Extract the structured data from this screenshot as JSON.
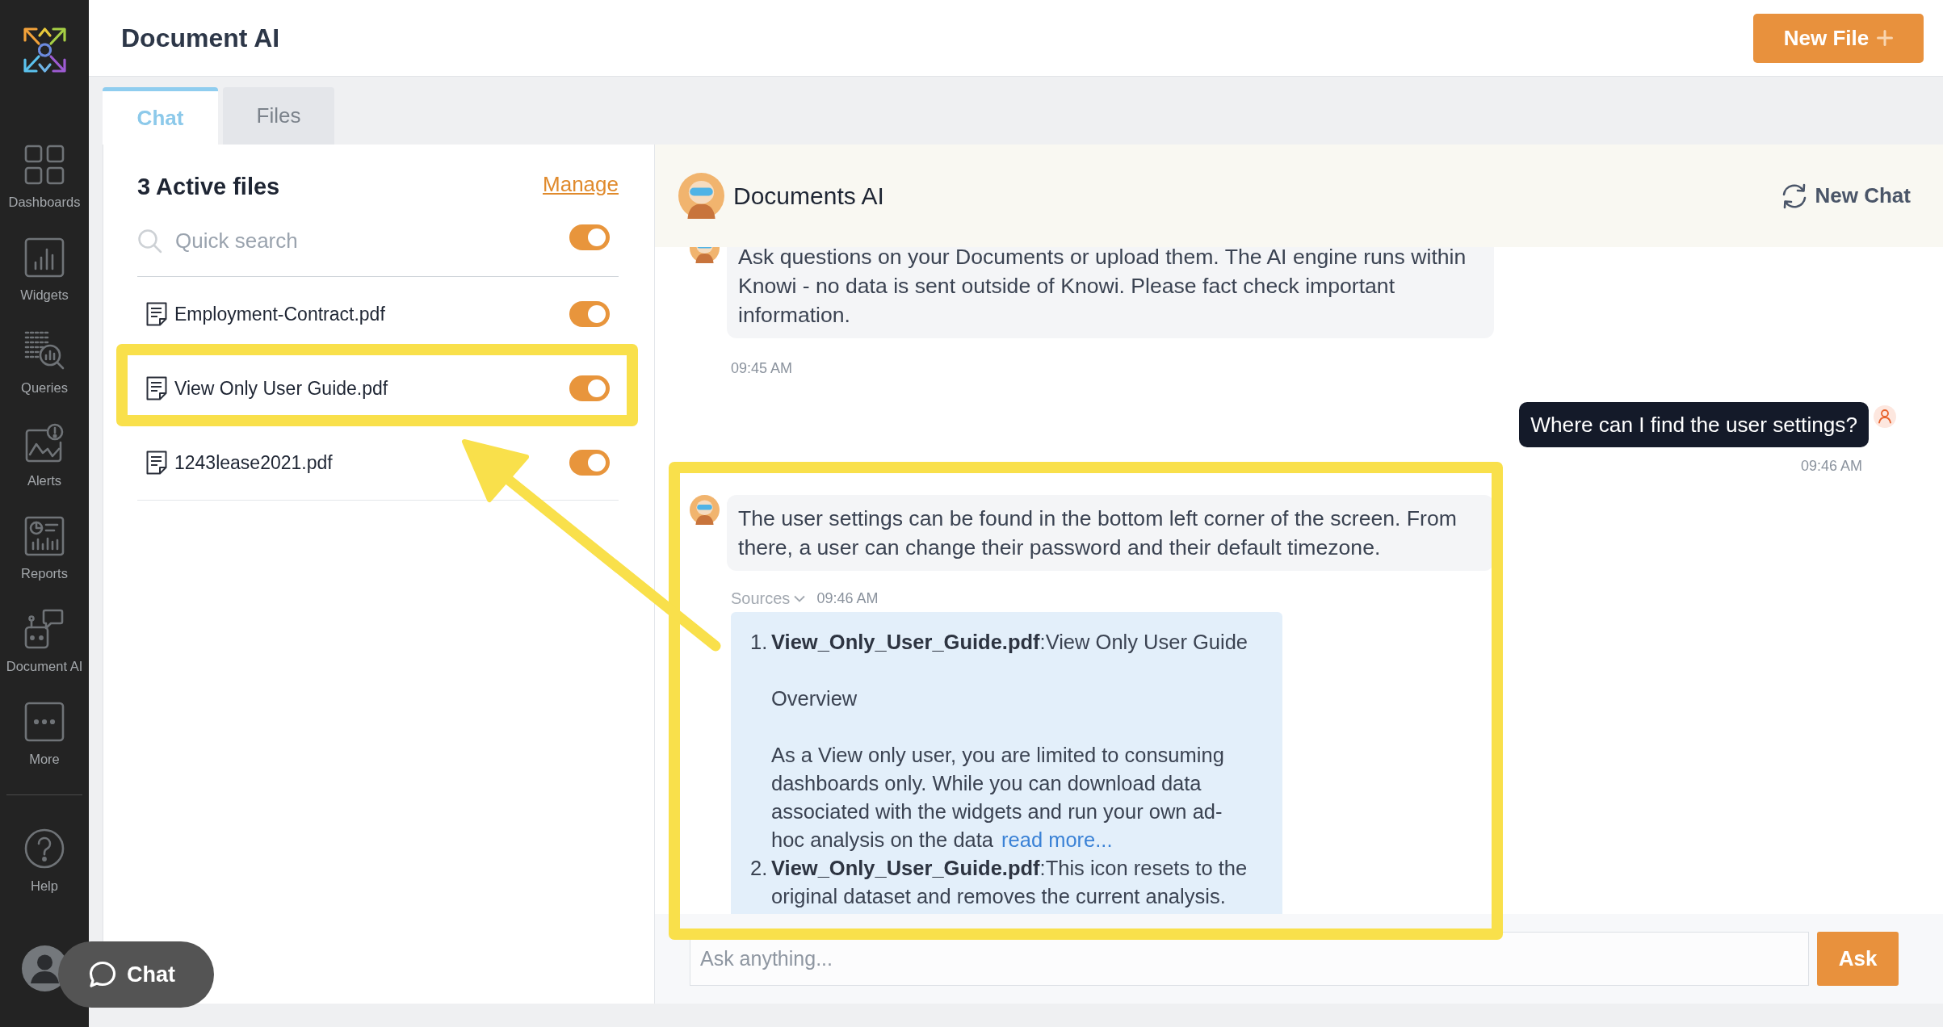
{
  "sidebar": {
    "items": [
      {
        "label": "Dashboards"
      },
      {
        "label": "Widgets"
      },
      {
        "label": "Queries"
      },
      {
        "label": "Alerts"
      },
      {
        "label": "Reports"
      },
      {
        "label": "Document AI"
      },
      {
        "label": "More"
      }
    ],
    "help": {
      "label": "Help"
    }
  },
  "header": {
    "title": "Document AI",
    "new_file_button": "New File"
  },
  "tabs": [
    {
      "label": "Chat",
      "selected": true
    },
    {
      "label": "Files",
      "selected": false
    }
  ],
  "files_panel": {
    "title": "3 Active files",
    "manage_link": "Manage",
    "search": {
      "placeholder": "Quick search",
      "toggle_on": true
    },
    "files": [
      {
        "name": "Employment-Contract.pdf",
        "on": true,
        "highlighted": false
      },
      {
        "name": "View Only User Guide.pdf",
        "on": true,
        "highlighted": true
      },
      {
        "name": "1243lease2021.pdf",
        "on": true,
        "highlighted": false
      }
    ]
  },
  "conversation": {
    "title": "Documents AI",
    "new_chat_button": "New Chat",
    "messages": [
      {
        "kind": "bot",
        "text": "Ask questions on your Documents or upload them. The AI engine runs within Knowi - no data is sent outside of Knowi. Please fact check important information.",
        "time": "09:45 AM",
        "highlighted": false
      },
      {
        "kind": "user",
        "text": "Where can I find the user settings?",
        "time": "09:46 AM",
        "highlighted": false
      },
      {
        "kind": "bot",
        "text": "The user settings can be found in the bottom left corner of the screen. From there, a user can change their password and their default timezone.",
        "sources_label": "Sources",
        "time": "09:46 AM",
        "highlighted": true,
        "sources": [
          {
            "number": "1.",
            "title": "**View_Only_User_Guide.pdf**:View Only User Guide",
            "paragraphs": [
              "Overview",
              "As a View only user, you are limited to consuming dashboards only. While you can download data associated with the widgets and run your own ad-hoc analysis on the data"
            ],
            "read_more": "read more..."
          },
          {
            "number": "2.",
            "title": "**View_Only_User_Guide.pdf**:This icon resets to the original dataset and removes the current analysis."
          }
        ]
      }
    ],
    "input": {
      "placeholder": "Ask anything...",
      "button": "Ask"
    }
  },
  "chat_widget": {
    "label": "Chat"
  },
  "callout_arrow": true
}
